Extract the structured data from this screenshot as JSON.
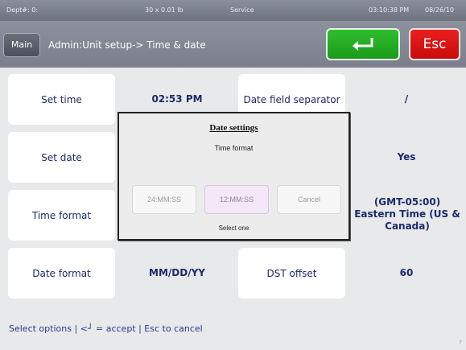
{
  "status_bar": {
    "dept": "Dept#: 0:",
    "weight": "30 x 0.01 lb",
    "mode": "Service",
    "time": "03:10:38 PM",
    "date": "08/26/10"
  },
  "header": {
    "main_label": "Main",
    "breadcrumb": "Admin:Unit setup-> Time & date",
    "accept_icon": "enter-arrow-icon",
    "esc_label": "Esc"
  },
  "settings": {
    "set_time": {
      "label": "Set time",
      "value": "02:53 PM"
    },
    "set_date": {
      "label": "Set date"
    },
    "time_format": {
      "label": "Time format"
    },
    "date_format": {
      "label": "Date format",
      "value": "MM/DD/YY"
    },
    "date_field_separator": {
      "label": "Date field separator",
      "value": "/"
    },
    "dst": {
      "value": "Yes"
    },
    "time_zone": {
      "value_line1": "(GMT-05:00)",
      "value_line2": "Eastern Time (US &",
      "value_line3": "Canada)"
    },
    "dst_offset": {
      "label": "DST offset",
      "value": "60"
    }
  },
  "footer": {
    "prefix": "Select options | <",
    "glyph": "┘",
    "suffix": " = accept | Esc to cancel"
  },
  "dialog": {
    "title": "Date settings",
    "subtitle": "Time format",
    "options": [
      "24:MM:SS",
      "12:MM:SS",
      "Cancel"
    ],
    "selected_option": "12:MM:SS",
    "instruction": "Select one"
  },
  "corner_mark": "r",
  "colors": {
    "accent_green": "#1fae1f",
    "accent_red": "#d81212",
    "header_gray": "#848995",
    "text_navy": "#1c2a6a"
  }
}
